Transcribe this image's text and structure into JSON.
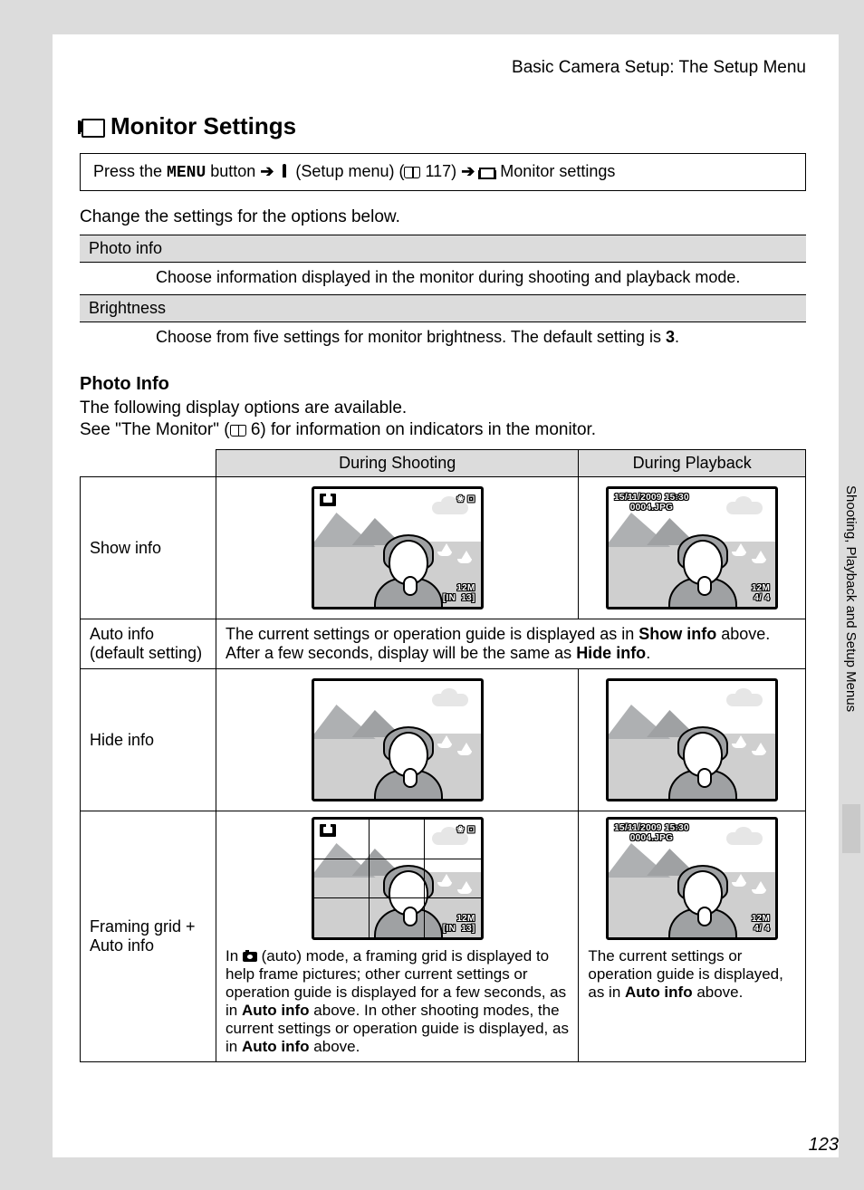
{
  "header": "Basic Camera Setup: The Setup Menu",
  "title": "Monitor Settings",
  "nav": {
    "prefix": "Press the ",
    "menu": "MENU",
    "part2": " button ",
    "arrow": "➔",
    "setup": " (Setup menu) (",
    "ref117": " 117) ",
    "tail": " Monitor settings"
  },
  "intro": "Change the settings for the options below.",
  "opts": {
    "photoinfo_h": "Photo info",
    "photoinfo_d": "Choose information displayed in the monitor during shooting and playback mode.",
    "bright_h": "Brightness",
    "bright_d_pre": "Choose from five settings for monitor brightness. The default setting is ",
    "bright_d_val": "3",
    "bright_d_post": "."
  },
  "photo_info_heading": "Photo Info",
  "photo_info_line1": "The following display options are available.",
  "photo_info_line2a": "See \"The Monitor\" (",
  "photo_info_line2b": " 6) for information on indicators in the monitor.",
  "table": {
    "col_shoot": "During Shooting",
    "col_play": "During Playback",
    "row1": "Show info",
    "row2a": "Auto info",
    "row2b": "(default setting)",
    "row2_desc_1": "The current settings or operation guide is displayed as in ",
    "row2_desc_b1": "Show info",
    "row2_desc_2": " above. After a few seconds, display will be the same as ",
    "row2_desc_b2": "Hide info",
    "row2_desc_3": ".",
    "row3": "Hide info",
    "row4": "Framing grid + Auto info",
    "row4_shoot_1": "In ",
    "row4_shoot_2": " (auto) mode, a framing grid is displayed to help frame pictures; other current settings or operation guide is displayed for a few seconds, as in ",
    "row4_shoot_b1": "Auto info",
    "row4_shoot_3": " above.  In other shooting modes, the current settings or operation guide is displayed, as in ",
    "row4_shoot_b2": "Auto info",
    "row4_shoot_4": " above.",
    "row4_play_1": "The current settings or operation guide is displayed, as in ",
    "row4_play_b1": "Auto info",
    "row4_play_2": " above."
  },
  "osd": {
    "date": "15/11/2009 15:30",
    "file": "0004.JPG",
    "count_play": "4/    4",
    "q12": "12M",
    "in13_a": "[IN",
    "in13_b": "13]",
    "tr_icons": "❀ ⊡"
  },
  "side_tab": "Shooting, Playback and Setup Menus",
  "page_num": "123"
}
